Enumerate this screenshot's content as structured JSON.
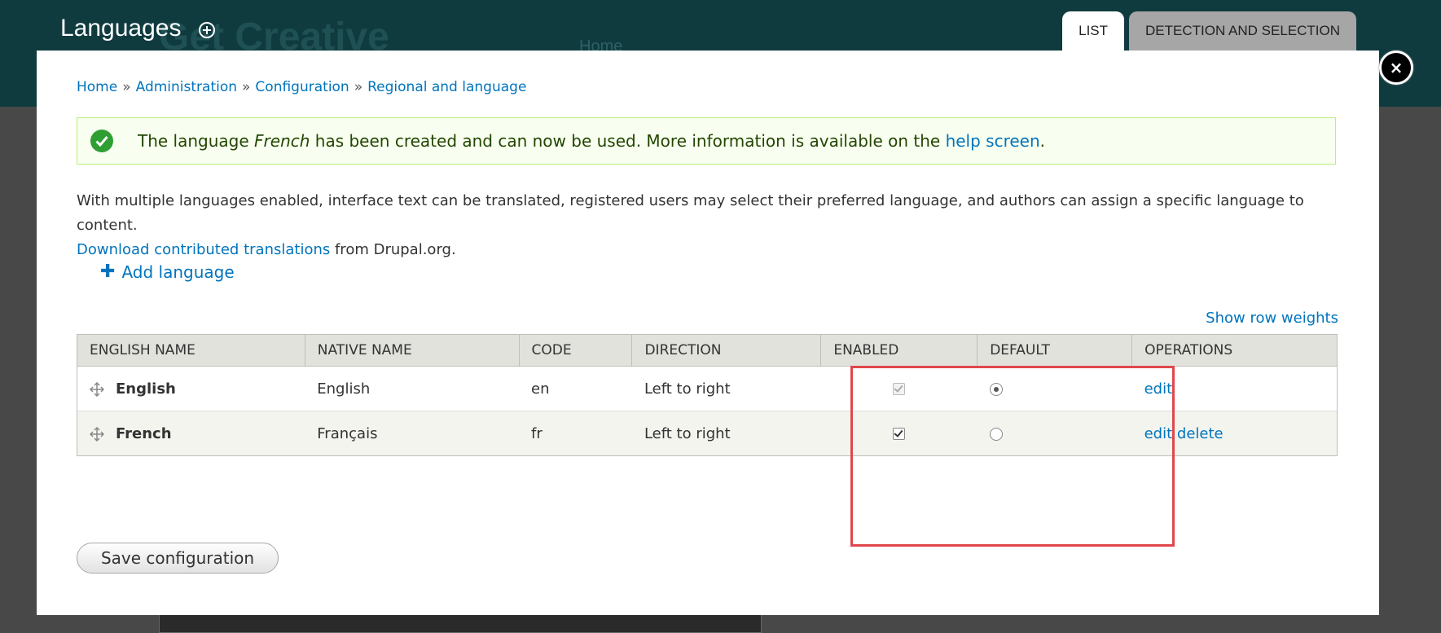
{
  "background": {
    "site_name": "Get Creative",
    "nav_home": "Home"
  },
  "overlay": {
    "title": "Languages",
    "tabs": [
      {
        "label": "LIST",
        "active": true
      },
      {
        "label": "DETECTION AND SELECTION",
        "active": false
      }
    ],
    "close_label": "×"
  },
  "breadcrumb": [
    "Home",
    "Administration",
    "Configuration",
    "Regional and language"
  ],
  "breadcrumb_separator": "»",
  "message": {
    "before": "The language ",
    "language": "French",
    "middle": " has been created and can now be used. More information is available on the ",
    "link": "help screen",
    "after": "."
  },
  "description": {
    "text": "With multiple languages enabled, interface text can be translated, registered users may select their preferred language, and authors can assign a specific language to content.",
    "link": "Download contributed translations",
    "link_suffix": " from Drupal.org."
  },
  "add_language": "Add language",
  "show_row_weights": "Show row weights",
  "table": {
    "headers": [
      "ENGLISH NAME",
      "NATIVE NAME",
      "CODE",
      "DIRECTION",
      "ENABLED",
      "DEFAULT",
      "OPERATIONS"
    ],
    "rows": [
      {
        "english": "English",
        "native": "English",
        "code": "en",
        "direction": "Left to right",
        "enabled": true,
        "enabled_disabled": true,
        "default": true,
        "ops": [
          "edit"
        ]
      },
      {
        "english": "French",
        "native": "Français",
        "code": "fr",
        "direction": "Left to right",
        "enabled": true,
        "enabled_disabled": false,
        "default": false,
        "ops": [
          "edit",
          "delete"
        ]
      }
    ]
  },
  "save_button": "Save configuration",
  "colors": {
    "link": "#0074bd",
    "header_bg": "#0f3b3f",
    "highlight": "#e0474c",
    "success_bg": "#f8fff0"
  }
}
